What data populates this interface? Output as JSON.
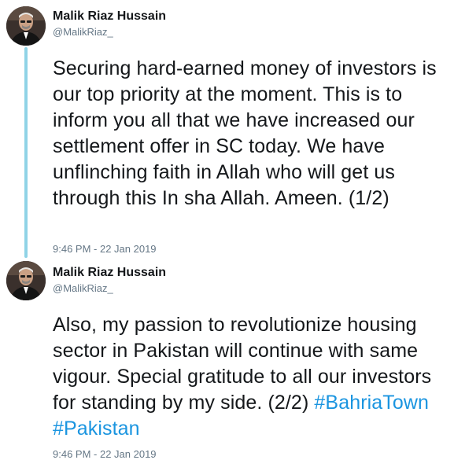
{
  "tweets": [
    {
      "display_name": "Malik Riaz Hussain",
      "handle": "@MalikRiaz_",
      "avatar_icon": "profile-photo",
      "text": "Securing hard-earned money of investors is our top priority at the moment. This is to inform you all that we have increased our settlement offer in SC today. We have unflinching faith in Allah who will get us through this In sha Allah. Ameen. (1/2)",
      "timestamp": "9:46 PM - 22 Jan 2019"
    },
    {
      "display_name": "Malik Riaz Hussain",
      "handle": "@MalikRiaz_",
      "avatar_icon": "profile-photo",
      "text": "Also, my passion to revolutionize housing sector in Pakistan will continue with same vigour. Special gratitude to all our investors for standing by my side. (2/2)",
      "hashtags": [
        "#BahriaTown",
        "#Pakistan"
      ],
      "timestamp": "9:46 PM - 22 Jan 2019"
    }
  ],
  "colors": {
    "thread_line": "#8fd3e6",
    "hashtag": "#1b95e0",
    "secondary_text": "#657786",
    "primary_text": "#14171a"
  }
}
